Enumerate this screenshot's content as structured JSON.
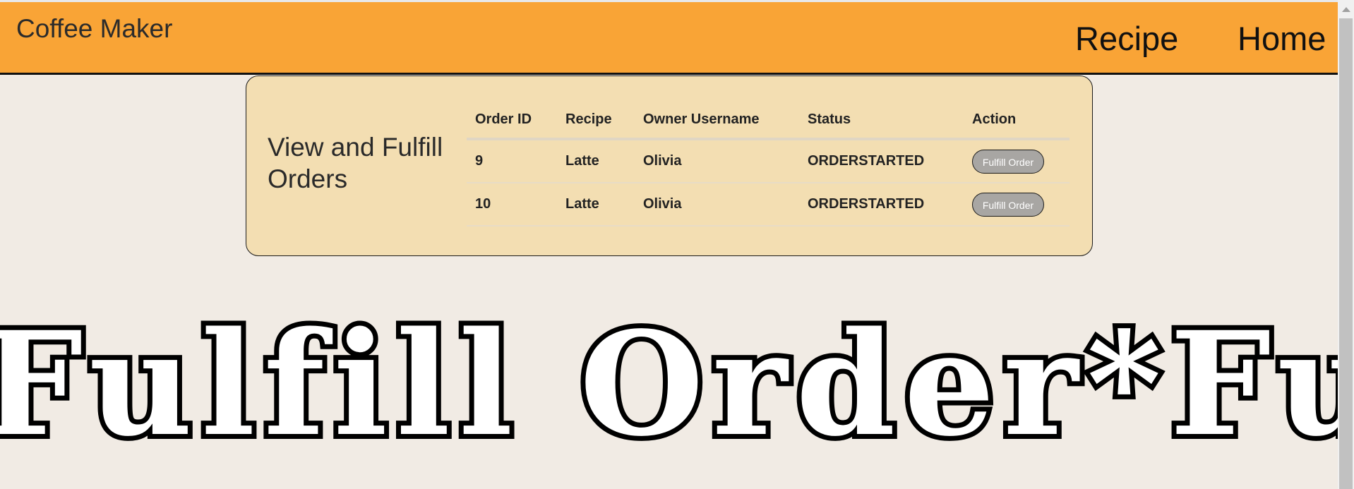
{
  "navbar": {
    "brand": "Coffee Maker",
    "links": [
      "Recipe",
      "Home"
    ]
  },
  "panel": {
    "title": "View and Fulfill Orders",
    "columns": [
      "Order ID",
      "Recipe",
      "Owner Username",
      "Status",
      "Action"
    ],
    "rows": [
      {
        "id": "9",
        "recipe": "Latte",
        "owner": "Olivia",
        "status": "ORDERSTARTED",
        "action": "Fulfill Order"
      },
      {
        "id": "10",
        "recipe": "Latte",
        "owner": "Olivia",
        "status": "ORDERSTARTED",
        "action": "Fulfill Order"
      }
    ]
  },
  "banner": {
    "text": "Fulfill Order*Fulfill"
  },
  "colors": {
    "navbar": "#f9a436",
    "page_background": "#f1ebe4",
    "panel_background": "#f3deb2",
    "button": "#a8a6a3"
  }
}
